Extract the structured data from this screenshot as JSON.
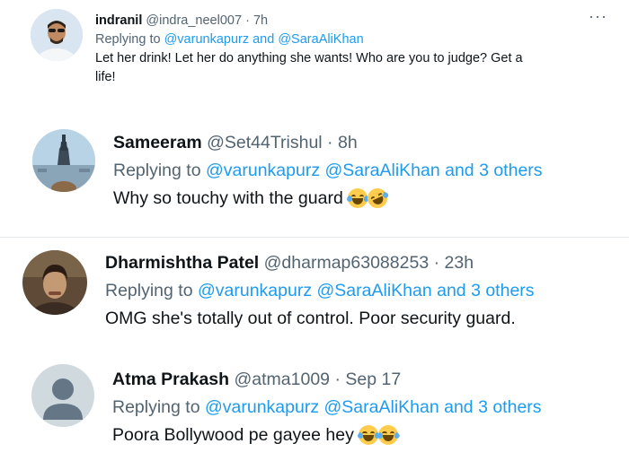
{
  "tweets": [
    {
      "name": "indranil",
      "handle": "@indra_neel007",
      "sep": "·",
      "time": "7h",
      "reply_prefix": "Replying to",
      "reply_to": "@varunkapurz and @SaraAliKhan",
      "text_line1": "Let her drink! Let her do anything she wants! Who are you to judge? Get a",
      "text_line2": "life!",
      "more_icon": "more-icon",
      "more_label": "···"
    },
    {
      "name": "Sameeram",
      "handle": "@Set44Trishul",
      "sep": "·",
      "time": "8h",
      "reply_prefix": "Replying to",
      "reply_to": "@varunkapurz @SaraAliKhan and 3 others",
      "text": "Why so touchy with the guard",
      "emojis": [
        "face-with-tears-of-joy-emoji",
        "rolling-on-floor-laughing-emoji"
      ]
    },
    {
      "name": "Dharmishtha Patel",
      "handle": "@dharmap63088253",
      "sep": "·",
      "time": "23h",
      "reply_prefix": "Replying to",
      "reply_to": "@varunkapurz @SaraAliKhan and 3 others",
      "text": "OMG she's totally out of control. Poor security guard."
    },
    {
      "name": "Atma Prakash",
      "handle": "@atma1009",
      "sep": "·",
      "time": "Sep 17",
      "reply_prefix": "Replying to",
      "reply_to": "@varunkapurz @SaraAliKhan and 3 others",
      "text": "Poora Bollywood pe gayee hey",
      "emojis": [
        "face-with-tears-of-joy-emoji",
        "face-with-tears-of-joy-emoji"
      ]
    }
  ],
  "colors": {
    "link": "#1d9bf0",
    "muted": "#536471",
    "text": "#0f1419",
    "divider": "#e6e9eb"
  }
}
